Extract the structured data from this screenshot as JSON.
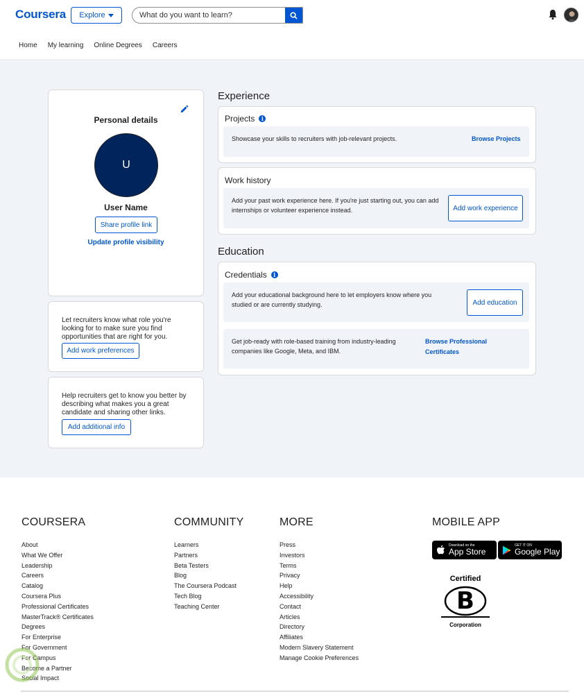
{
  "header": {
    "logo": "Coursera",
    "explore_label": "Explore",
    "search_placeholder": "What do you want to learn?",
    "nav": [
      "Home",
      "My learning",
      "Online Degrees",
      "Careers"
    ]
  },
  "personal": {
    "title": "Personal details",
    "avatar_initial": "U",
    "username": "User Name",
    "share_label": "Share profile link",
    "visibility_label": "Update profile visibility"
  },
  "preferences": {
    "text": "Let recruiters know what role you're looking for to make sure you find opportunities that are right for you.",
    "button": "Add work preferences"
  },
  "additional": {
    "text": "Help recruiters get to know you better by describing what makes you a great candidate and sharing other links.",
    "button": "Add additional info"
  },
  "experience": {
    "heading": "Experience",
    "projects": {
      "title": "Projects",
      "text": "Showcase your skills to recruiters with job-relevant projects.",
      "link": "Browse Projects"
    },
    "work": {
      "title": "Work history",
      "text": "Add your past work experience here. If you're just starting out, you can add internships or volunteer experience instead.",
      "button": "Add work experience"
    }
  },
  "education": {
    "heading": "Education",
    "credentials": {
      "title": "Credentials",
      "text": "Add your educational background here to let employers know where you studied or are currently studying.",
      "button": "Add education",
      "training_text": "Get job-ready with role-based training from industry-leading companies like Google, Meta, and IBM.",
      "training_link": "Browse Professional Certificates"
    }
  },
  "footer": {
    "coursera": {
      "heading": "COURSERA",
      "items": [
        "About",
        "What We Offer",
        "Leadership",
        "Careers",
        "Catalog",
        "Coursera Plus",
        "Professional Certificates",
        "MasterTrack® Certificates",
        "Degrees",
        "For Enterprise",
        "For Government",
        "For Campus",
        "Become a Partner",
        "Social Impact"
      ]
    },
    "community": {
      "heading": "COMMUNITY",
      "items": [
        "Learners",
        "Partners",
        "Beta Testers",
        "Blog",
        "The Coursera Podcast",
        "Tech Blog",
        "Teaching Center"
      ]
    },
    "more": {
      "heading": "MORE",
      "items": [
        "Press",
        "Investors",
        "Terms",
        "Privacy",
        "Help",
        "Accessibility",
        "Contact",
        "Articles",
        "Directory",
        "Affiliates",
        "Modern Slavery Statement",
        "Manage Cookie Preferences"
      ]
    },
    "mobile": {
      "heading": "MOBILE APP",
      "appstore_small": "Download on the",
      "appstore_big": "App Store",
      "google_small": "GET IT ON",
      "google_big": "Google Play",
      "bcorp_top": "Certified",
      "bcorp_letter": "B",
      "bcorp_bottom": "Corporation"
    }
  },
  "colors": {
    "brand": "#0056d2",
    "avatar_bg": "#00245c",
    "page_bg": "#f0f3f7"
  }
}
